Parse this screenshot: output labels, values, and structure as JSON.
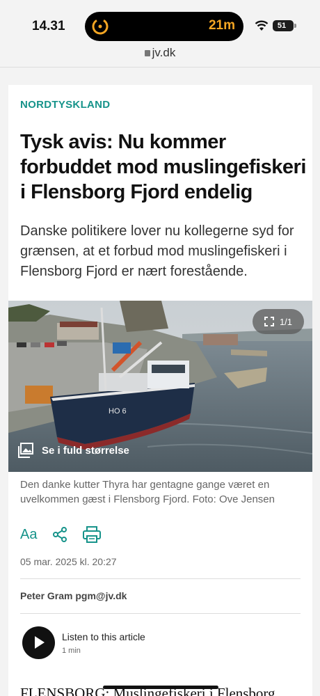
{
  "status_bar": {
    "time": "14.31",
    "timer": "21m",
    "battery": "51"
  },
  "browser": {
    "url": "jv.dk"
  },
  "article": {
    "section": "NORDTYSKLAND",
    "headline": "Tysk avis: Nu kommer forbuddet mod muslingefiskeri i Flensborg Fjord endelig",
    "lead": "Danske politikere lover nu kollegerne syd for grænsen, at et forbud mod muslingefiskeri i Flensborg Fjord er nært forestående.",
    "image": {
      "counter": "1/1",
      "fullsize_label": "Se i fuld størrelse",
      "boat_id": "HO 6"
    },
    "caption": "Den danke kutter Thyra har gentagne gange været en uvelkommen gæst i Flensborg Fjord. Foto: Ove Jensen",
    "tools": {
      "font_size_label": "Aa",
      "share_icon": "share-icon",
      "print_icon": "print-icon"
    },
    "date": "05 mar. 2025 kl. 20:27",
    "author": "Peter Gram pgm@jv.dk",
    "audio": {
      "title": "Listen to this article",
      "duration": "1 min"
    },
    "body_start": "FLENSBORG: Muslingefiskeri i Flensborg"
  },
  "colors": {
    "accent": "#16938a",
    "timer": "#f5a623"
  }
}
